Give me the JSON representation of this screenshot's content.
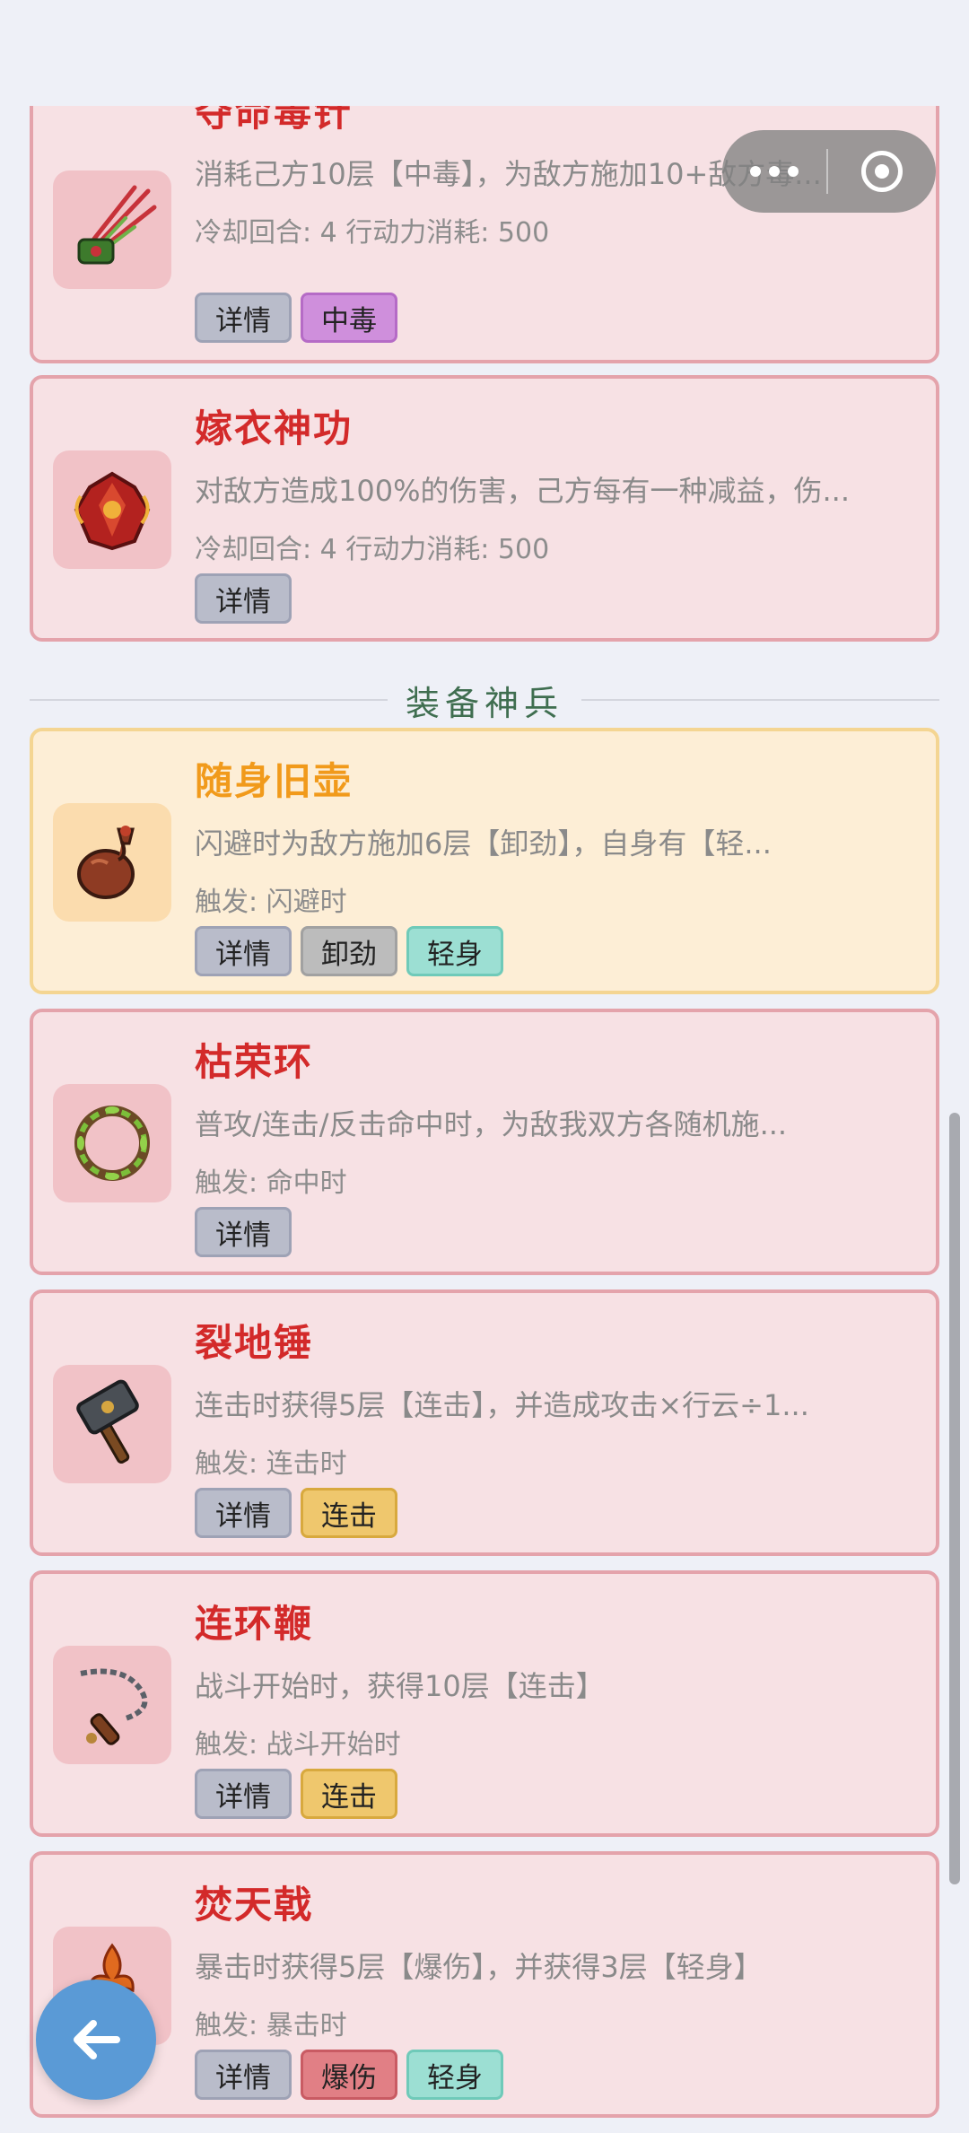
{
  "top_cards": [
    {
      "title": "夺命毒针",
      "desc": "消耗己方10层【中毒】，为敌方施加10+敌方毒...",
      "meta": "冷却回合: 4  行动力消耗: 500",
      "tags": [
        "详情",
        "中毒"
      ],
      "icon": "poison-needles-icon"
    },
    {
      "title": "嫁衣神功",
      "desc": "对敌方造成100%的伤害，己方每有一种减益，伤...",
      "meta": "冷却回合: 4  行动力消耗: 500",
      "tags": [
        "详情"
      ],
      "icon": "red-robe-icon"
    }
  ],
  "section_title": "装备神兵",
  "equip_cards": [
    {
      "title": "随身旧壶",
      "desc": "闪避时为敌方施加6层【卸劲】，自身有【轻...",
      "meta": "触发: 闪避时",
      "tags": [
        "详情",
        "卸劲",
        "轻身"
      ],
      "icon": "gourd-flask-icon"
    },
    {
      "title": "枯荣环",
      "desc": "普攻/连击/反击命中时，为敌我双方各随机施...",
      "meta": "触发: 命中时",
      "tags": [
        "详情"
      ],
      "icon": "wreath-ring-icon"
    },
    {
      "title": "裂地锤",
      "desc": "连击时获得5层【连击】，并造成攻击×行云÷1...",
      "meta": "触发: 连击时",
      "tags": [
        "详情",
        "连击"
      ],
      "icon": "hammer-icon"
    },
    {
      "title": "连环鞭",
      "desc": "战斗开始时，获得10层【连击】",
      "meta": "触发: 战斗开始时",
      "tags": [
        "详情",
        "连击"
      ],
      "icon": "chain-whip-icon"
    },
    {
      "title": "焚天戟",
      "desc": "暴击时获得5层【爆伤】，并获得3层【轻身】",
      "meta": "触发: 暴击时",
      "tags": [
        "详情",
        "爆伤",
        "轻身"
      ],
      "icon": "flame-halberd-icon"
    }
  ],
  "colors": {
    "card_bg": "#f7e1e4",
    "card_border": "#e4a3ab",
    "gold_card_bg": "#fdeed6",
    "title_red": "#d32a2a",
    "title_orange": "#f19a1b",
    "section_green": "#3f6e50",
    "back_button": "#5a9ad6"
  },
  "capsule": {
    "more_icon": "more-dots-icon",
    "close_icon": "target-circle-icon"
  },
  "back_button_icon": "arrow-left-icon"
}
